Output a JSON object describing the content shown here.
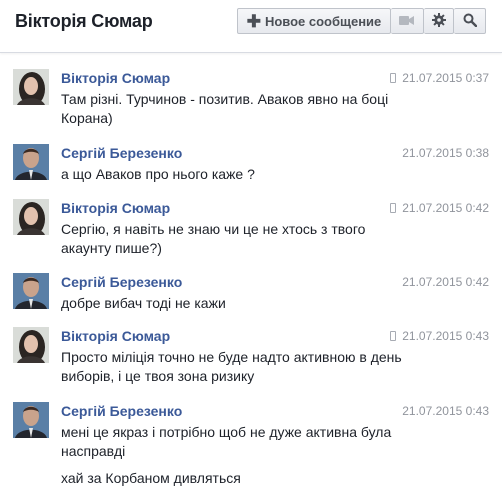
{
  "header": {
    "title": "Вікторія Сюмар",
    "new_message_label": "Новое сообщение"
  },
  "messages": [
    {
      "author": "Вікторія Сюмар",
      "time": "21.07.2015 0:37",
      "mobile": true,
      "lines": [
        "Там різні. Турчинов - позитив. Аваков явно на боці",
        "Корана)"
      ]
    },
    {
      "author": "Сергій Березенко",
      "time": "21.07.2015 0:38",
      "mobile": false,
      "lines": [
        "а що Аваков про нього каже ?"
      ]
    },
    {
      "author": "Вікторія Сюмар",
      "time": "21.07.2015 0:42",
      "mobile": true,
      "lines": [
        "Сергію, я навіть не знаю чи це не хтось з твого",
        "акаунту пише?)"
      ]
    },
    {
      "author": "Сергій Березенко",
      "time": "21.07.2015 0:42",
      "mobile": false,
      "lines": [
        "добре вибач тоді не кажи"
      ]
    },
    {
      "author": "Вікторія Сюмар",
      "time": "21.07.2015 0:43",
      "mobile": true,
      "lines": [
        "Просто міліція точно не буде надто активною в день",
        "виборів, і це твоя зона ризику"
      ]
    },
    {
      "author": "Сергій Березенко",
      "time": "21.07.2015 0:43",
      "mobile": false,
      "lines": [
        "мені це якраз і потрібно щоб не дуже активна була",
        "насправді"
      ]
    }
  ],
  "extra_message": "хай за Корбаном дивляться",
  "icons": {
    "new_message": "plus-icon",
    "video": "video-camera-icon",
    "settings": "gear-icon",
    "search": "search-icon",
    "mobile": "mobile-phone-icon"
  }
}
